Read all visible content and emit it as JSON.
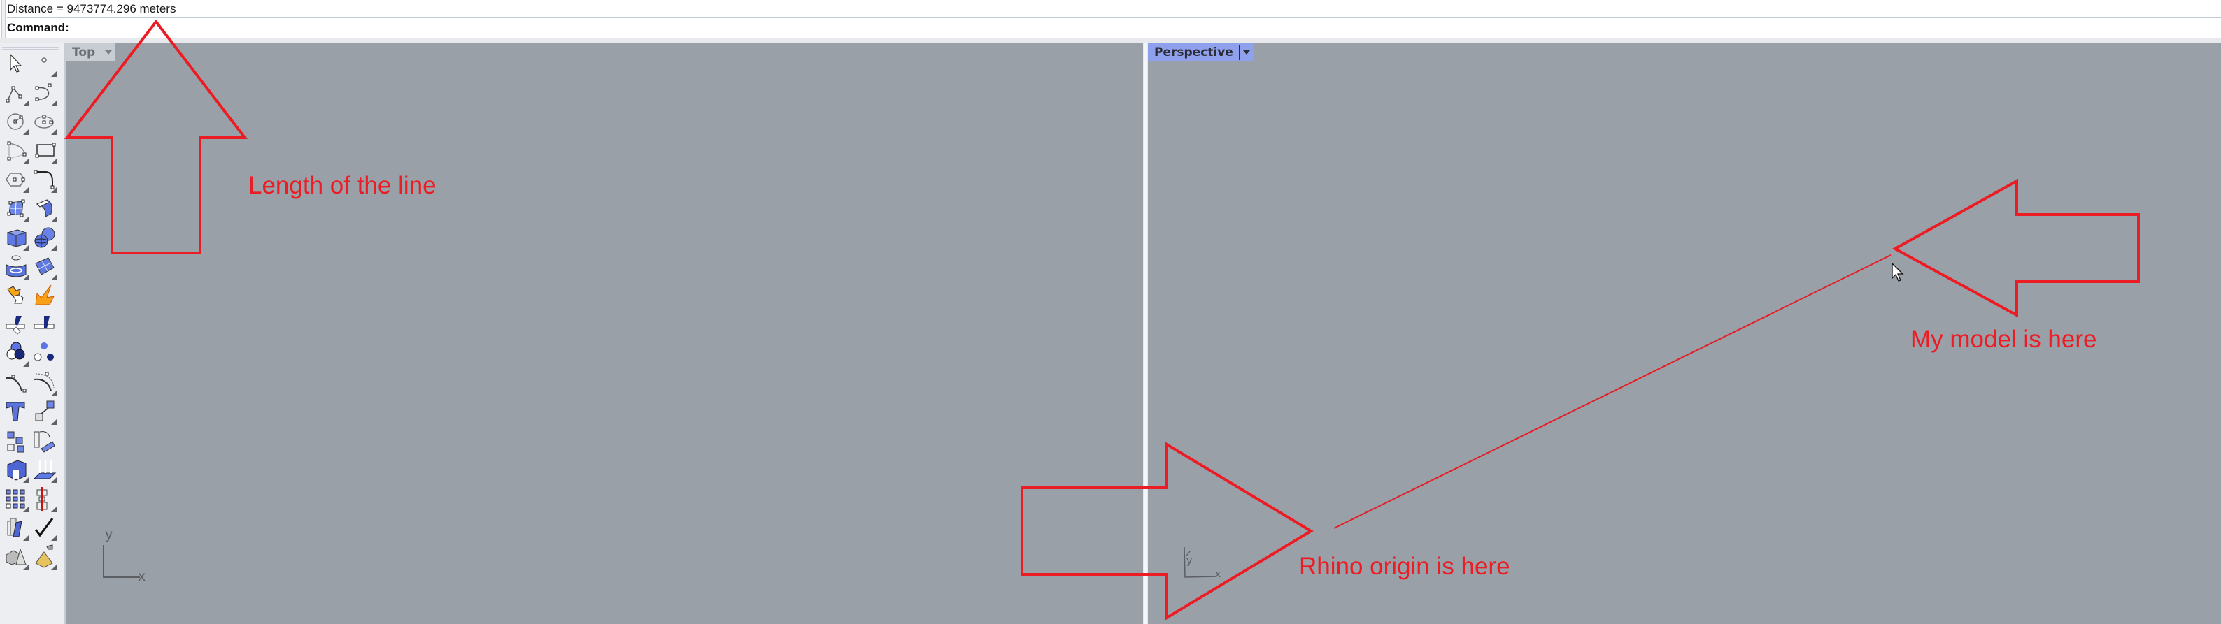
{
  "command_area": {
    "history_line": "Distance = 9473774.296 meters",
    "prompt": "Command:",
    "input_value": ""
  },
  "toolbar": {
    "tools": [
      {
        "name": "select-icon",
        "flyout": false
      },
      {
        "name": "point-icon",
        "flyout": true
      },
      {
        "name": "polyline-icon",
        "flyout": true
      },
      {
        "name": "curve-icon",
        "flyout": true
      },
      {
        "name": "circle-icon",
        "flyout": true
      },
      {
        "name": "ellipse-icon",
        "flyout": true
      },
      {
        "name": "arc-icon",
        "flyout": true
      },
      {
        "name": "rectangle-icon",
        "flyout": true
      },
      {
        "name": "polygon-icon",
        "flyout": true
      },
      {
        "name": "fillet-curve-icon",
        "flyout": true
      },
      {
        "name": "surface-from-points-icon",
        "flyout": true
      },
      {
        "name": "extrude-surface-icon",
        "flyout": true
      },
      {
        "name": "box-icon",
        "flyout": true
      },
      {
        "name": "sphere-icon",
        "flyout": true
      },
      {
        "name": "extrude-curve-icon",
        "flyout": true
      },
      {
        "name": "mesh-icon",
        "flyout": true
      },
      {
        "name": "boolean-union-icon",
        "flyout": false
      },
      {
        "name": "explode-icon",
        "flyout": false
      },
      {
        "name": "trim-icon",
        "flyout": false
      },
      {
        "name": "split-icon",
        "flyout": false
      },
      {
        "name": "boolean-icon",
        "flyout": true
      },
      {
        "name": "group-icon",
        "flyout": false
      },
      {
        "name": "fillet-edge-icon",
        "flyout": false
      },
      {
        "name": "offset-curve-icon",
        "flyout": true
      },
      {
        "name": "text-icon",
        "flyout": false
      },
      {
        "name": "move-icon",
        "flyout": true
      },
      {
        "name": "array-icon",
        "flyout": false
      },
      {
        "name": "rotate-icon",
        "flyout": false
      },
      {
        "name": "solid-edit-icon",
        "flyout": true
      },
      {
        "name": "project-icon",
        "flyout": true
      },
      {
        "name": "grid-array-icon",
        "flyout": true
      },
      {
        "name": "dimension-icon",
        "flyout": true
      },
      {
        "name": "analyze-icon",
        "flyout": true
      },
      {
        "name": "check-icon",
        "flyout": true
      },
      {
        "name": "render-primitives-icon",
        "flyout": true
      },
      {
        "name": "render-pyramid-icon",
        "flyout": true
      }
    ]
  },
  "viewports": {
    "top": {
      "label": "Top",
      "axis_x": "x",
      "axis_y": "y",
      "active": false
    },
    "perspective": {
      "label": "Perspective",
      "axis_x": "x",
      "axis_y": "y",
      "axis_z": "z",
      "active": true
    }
  },
  "annotations": {
    "length": "Length of the line",
    "model": "My model is here",
    "origin": "Rhino origin is here"
  },
  "colors": {
    "viewport_bg": "#9aa0a8",
    "active_tab": "#8fa0ec",
    "annotation_red": "#ec1c24"
  }
}
